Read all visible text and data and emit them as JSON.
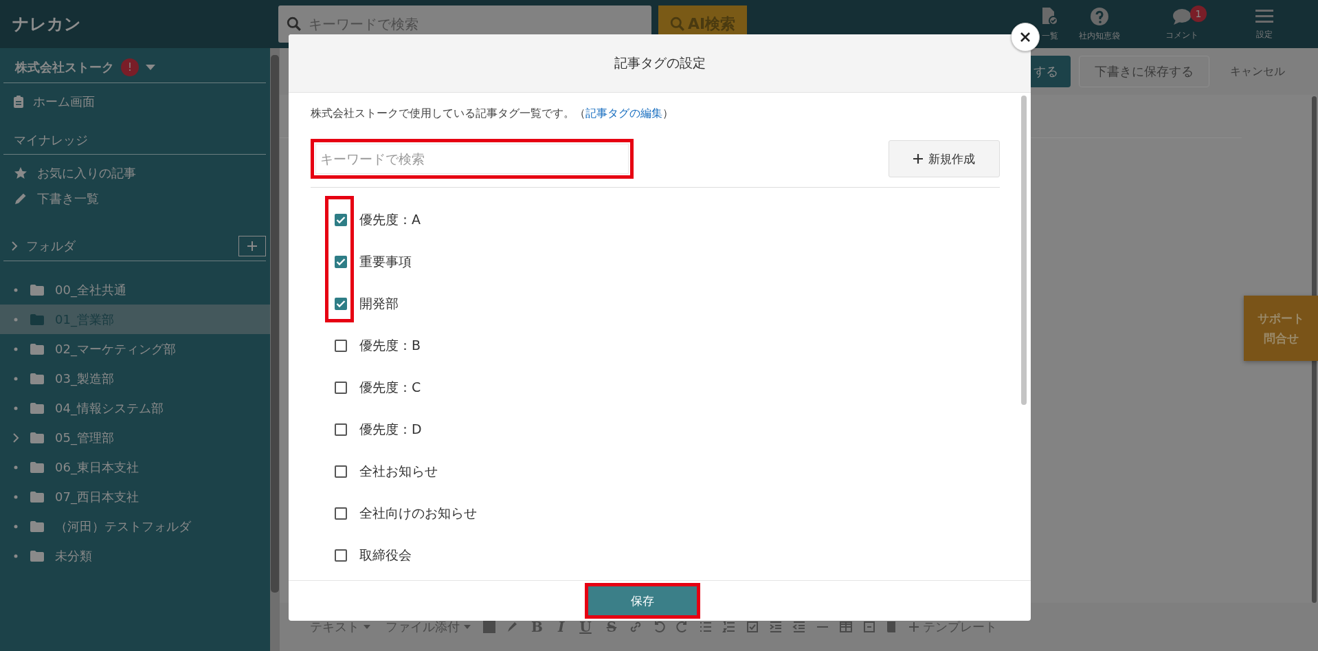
{
  "app": {
    "logo": "ナレカン"
  },
  "header": {
    "search": {
      "placeholder": "キーワードで検索"
    },
    "ai_button": "AI検索",
    "nav": [
      {
        "label": "一覧"
      },
      {
        "label": "社内知恵袋"
      },
      {
        "label": "コメント",
        "badge": "1"
      },
      {
        "label": "設定"
      }
    ]
  },
  "sidebar": {
    "company": "株式会社ストーク",
    "alert": "!",
    "home": "ホーム画面",
    "section": "マイナレッジ",
    "links": [
      "お気に入りの記事",
      "下書き一覧"
    ],
    "folders_title": "フォルダ",
    "folders": [
      {
        "label": "00_全社共通",
        "kind": "leaf",
        "selected": false
      },
      {
        "label": "01_営業部",
        "kind": "leaf",
        "selected": true
      },
      {
        "label": "02_マーケティング部",
        "kind": "leaf",
        "selected": false
      },
      {
        "label": "03_製造部",
        "kind": "leaf",
        "selected": false
      },
      {
        "label": "04_情報システム部",
        "kind": "leaf",
        "selected": false
      },
      {
        "label": "05_管理部",
        "kind": "branch",
        "selected": false
      },
      {
        "label": "06_東日本支社",
        "kind": "leaf",
        "selected": false
      },
      {
        "label": "07_西日本支社",
        "kind": "leaf",
        "selected": false
      },
      {
        "label": "（河田）テストフォルダ",
        "kind": "leaf",
        "selected": false
      },
      {
        "label": "未分類",
        "kind": "leaf",
        "selected": false
      }
    ]
  },
  "editor": {
    "actions": [
      "する",
      "下書きに保存する",
      "キャンセル"
    ],
    "toolbar": {
      "menus": [
        "テキスト",
        "ファイル添付"
      ],
      "glyphs": [
        "B",
        "I",
        "U",
        "S"
      ],
      "template": "テンプレート"
    }
  },
  "support_tab": [
    "サポート",
    "問合せ"
  ],
  "modal": {
    "title": "記事タグの設定",
    "description": "株式会社ストークで使用している記事タグ一覧です。（",
    "link": "記事タグの編集",
    "description_end": "）",
    "search": {
      "placeholder": "キーワードで検索"
    },
    "new_button": "新規作成",
    "tags": [
      {
        "label": "優先度：A",
        "checked": true
      },
      {
        "label": "重要事項",
        "checked": true
      },
      {
        "label": "開発部",
        "checked": true
      },
      {
        "label": "優先度：B",
        "checked": false
      },
      {
        "label": "優先度：C",
        "checked": false
      },
      {
        "label": "優先度：D",
        "checked": false
      },
      {
        "label": "全社お知らせ",
        "checked": false
      },
      {
        "label": "全社向けのお知らせ",
        "checked": false
      },
      {
        "label": "取締役会",
        "checked": false
      }
    ],
    "save_button": "保存"
  }
}
